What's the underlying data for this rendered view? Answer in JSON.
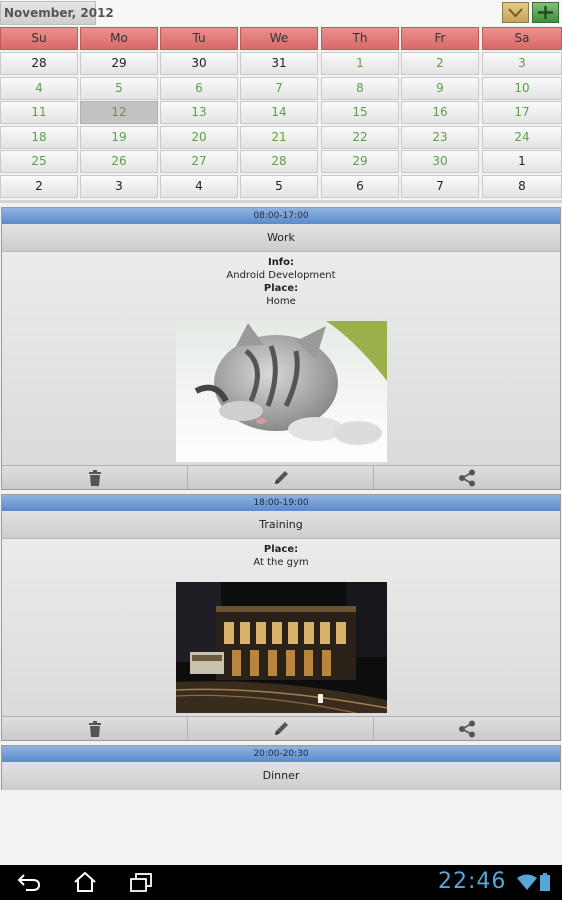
{
  "header": {
    "month_label": "November, 2012",
    "dropdown_icon": "chevron-down-icon",
    "add_icon": "plus-icon"
  },
  "calendar": {
    "weekdays": [
      "Su",
      "Mo",
      "Tu",
      "We",
      "Th",
      "Fr",
      "Sa"
    ],
    "weeks": [
      [
        "28",
        "29",
        "30",
        "31",
        "1",
        "2",
        "3"
      ],
      [
        "4",
        "5",
        "6",
        "7",
        "8",
        "9",
        "10"
      ],
      [
        "11",
        "12",
        "13",
        "14",
        "15",
        "16",
        "17"
      ],
      [
        "18",
        "19",
        "20",
        "21",
        "22",
        "23",
        "24"
      ],
      [
        "25",
        "26",
        "27",
        "28",
        "29",
        "30",
        "1"
      ],
      [
        "2",
        "3",
        "4",
        "5",
        "6",
        "7",
        "8"
      ]
    ],
    "selected_day": "12"
  },
  "events": [
    {
      "time": "08:00-17:00",
      "title": "Work",
      "info_label": "Info:",
      "info_value": "Android Development",
      "place_label": "Place:",
      "place_value": "Home"
    },
    {
      "time": "18:00-19:00",
      "title": "Training",
      "place_label": "Place:",
      "place_value": "At the gym"
    },
    {
      "time": "20:00-20:30",
      "title": "Dinner"
    }
  ],
  "actions": {
    "delete_icon": "trash-icon",
    "edit_icon": "pencil-icon",
    "share_icon": "share-icon"
  },
  "statusbar": {
    "clock": "22:46"
  },
  "colors": {
    "weekday_header": "#d76a6a",
    "current_month_text": "#5f9e4a",
    "time_bar": "#5b8acb",
    "clock": "#56a7d8"
  }
}
